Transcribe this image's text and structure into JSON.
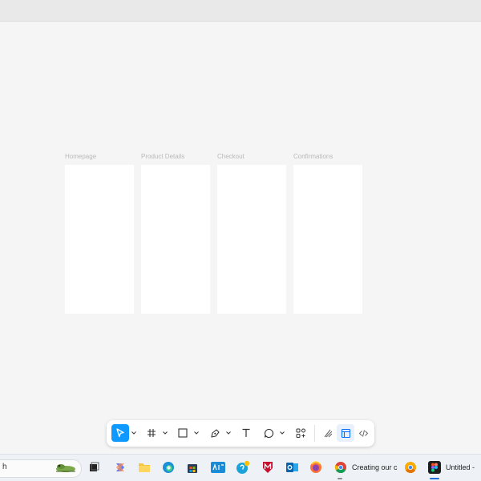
{
  "canvas": {
    "frames": [
      {
        "label": "Homepage"
      },
      {
        "label": "Product Details"
      },
      {
        "label": "Checkout"
      },
      {
        "label": "Confirmations"
      }
    ]
  },
  "toolbar": {
    "tools": [
      "move-tool",
      "frame-tool",
      "shape-tool",
      "pen-tool",
      "text-tool",
      "comment-tool",
      "actions-tool",
      "draw-mode",
      "design-mode",
      "dev-mode"
    ]
  },
  "taskbar": {
    "search_text": "h",
    "chrome_window_label": "Creating our c",
    "figma_window_label": "Untitled -"
  },
  "colors": {
    "accent": "#0d99ff",
    "canvas": "#f5f5f5",
    "frame": "#ffffff"
  }
}
